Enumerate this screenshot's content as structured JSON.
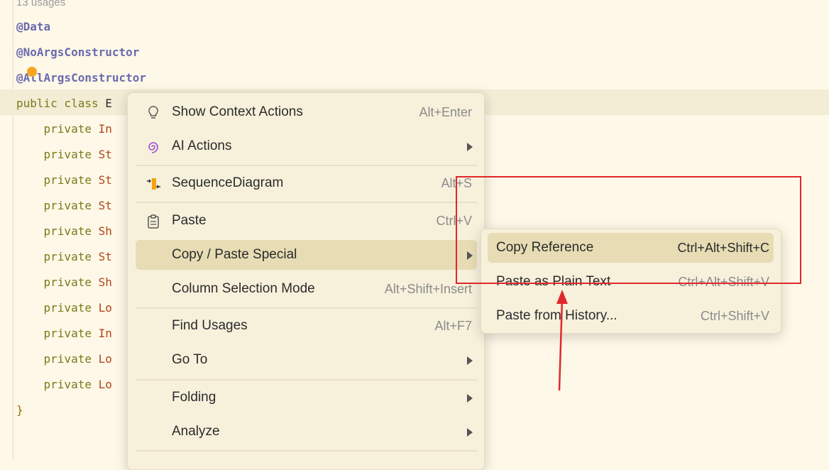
{
  "editor": {
    "usages_hint": "13 usages",
    "lines": [
      {
        "parts": [
          {
            "cls": "anno",
            "text": "@Data"
          }
        ]
      },
      {
        "parts": [
          {
            "cls": "anno",
            "text": "@NoArgsConstructor"
          }
        ]
      },
      {
        "parts": [
          {
            "cls": "anno",
            "text": "@AllArgsConstructor"
          }
        ]
      },
      {
        "parts": [
          {
            "cls": "kw",
            "text": "public class "
          },
          {
            "cls": "",
            "text": "E"
          }
        ]
      },
      {
        "parts": [
          {
            "cls": "kw",
            "text": "    private "
          },
          {
            "cls": "type",
            "text": "In"
          }
        ]
      },
      {
        "parts": [
          {
            "cls": "kw",
            "text": "    private "
          },
          {
            "cls": "type",
            "text": "St"
          }
        ]
      },
      {
        "parts": [
          {
            "cls": "kw",
            "text": "    private "
          },
          {
            "cls": "type",
            "text": "St"
          }
        ]
      },
      {
        "parts": [
          {
            "cls": "kw",
            "text": "    private "
          },
          {
            "cls": "type",
            "text": "St"
          }
        ]
      },
      {
        "parts": [
          {
            "cls": "kw",
            "text": "    private "
          },
          {
            "cls": "type",
            "text": "Sh"
          }
        ]
      },
      {
        "parts": [
          {
            "cls": "kw",
            "text": "    private "
          },
          {
            "cls": "type",
            "text": "St"
          }
        ]
      },
      {
        "parts": [
          {
            "cls": "kw",
            "text": "    private "
          },
          {
            "cls": "type",
            "text": "Sh"
          }
        ]
      },
      {
        "parts": [
          {
            "cls": "kw",
            "text": "    private "
          },
          {
            "cls": "type",
            "text": "Lo"
          }
        ]
      },
      {
        "parts": [
          {
            "cls": "kw",
            "text": "    private "
          },
          {
            "cls": "type",
            "text": "In"
          }
        ]
      },
      {
        "parts": [
          {
            "cls": "kw",
            "text": "    private "
          },
          {
            "cls": "type",
            "text": "Lo"
          }
        ]
      },
      {
        "parts": [
          {
            "cls": "kw",
            "text": "    private "
          },
          {
            "cls": "type",
            "text": "Lo"
          }
        ]
      },
      {
        "parts": [
          {
            "cls": "brace",
            "text": "}"
          }
        ]
      }
    ]
  },
  "context_menu": {
    "items": [
      {
        "label": "Show Context Actions",
        "shortcut": "Alt+Enter",
        "icon": "lightbulb-icon"
      },
      {
        "label": "AI Actions",
        "shortcut": "",
        "icon": "ai-spiral-icon",
        "submenu": true
      },
      {
        "label": "SequenceDiagram",
        "shortcut": "Alt+S",
        "icon": "sequence-diagram-icon"
      },
      {
        "label": "Paste",
        "shortcut": "Ctrl+V",
        "icon": "clipboard-icon"
      },
      {
        "label": "Copy / Paste Special",
        "shortcut": "",
        "submenu": true,
        "selected": true
      },
      {
        "label": "Column Selection Mode",
        "shortcut": "Alt+Shift+Insert"
      },
      {
        "label": "Find Usages",
        "shortcut": "Alt+F7"
      },
      {
        "label": "Go To",
        "shortcut": "",
        "submenu": true
      },
      {
        "label": "Folding",
        "shortcut": "",
        "submenu": true
      },
      {
        "label": "Analyze",
        "shortcut": "",
        "submenu": true
      }
    ]
  },
  "submenu": {
    "items": [
      {
        "label": "Copy Reference",
        "shortcut": "Ctrl+Alt+Shift+C",
        "selected": true
      },
      {
        "label": "Paste as Plain Text",
        "shortcut": "Ctrl+Alt+Shift+V"
      },
      {
        "label": "Paste from History...",
        "shortcut": "Ctrl+Shift+V"
      }
    ]
  },
  "colors": {
    "background": "#fdf8e7",
    "menu_selection": "#e7dcb4",
    "annotation_highlight": "#e0282c"
  }
}
